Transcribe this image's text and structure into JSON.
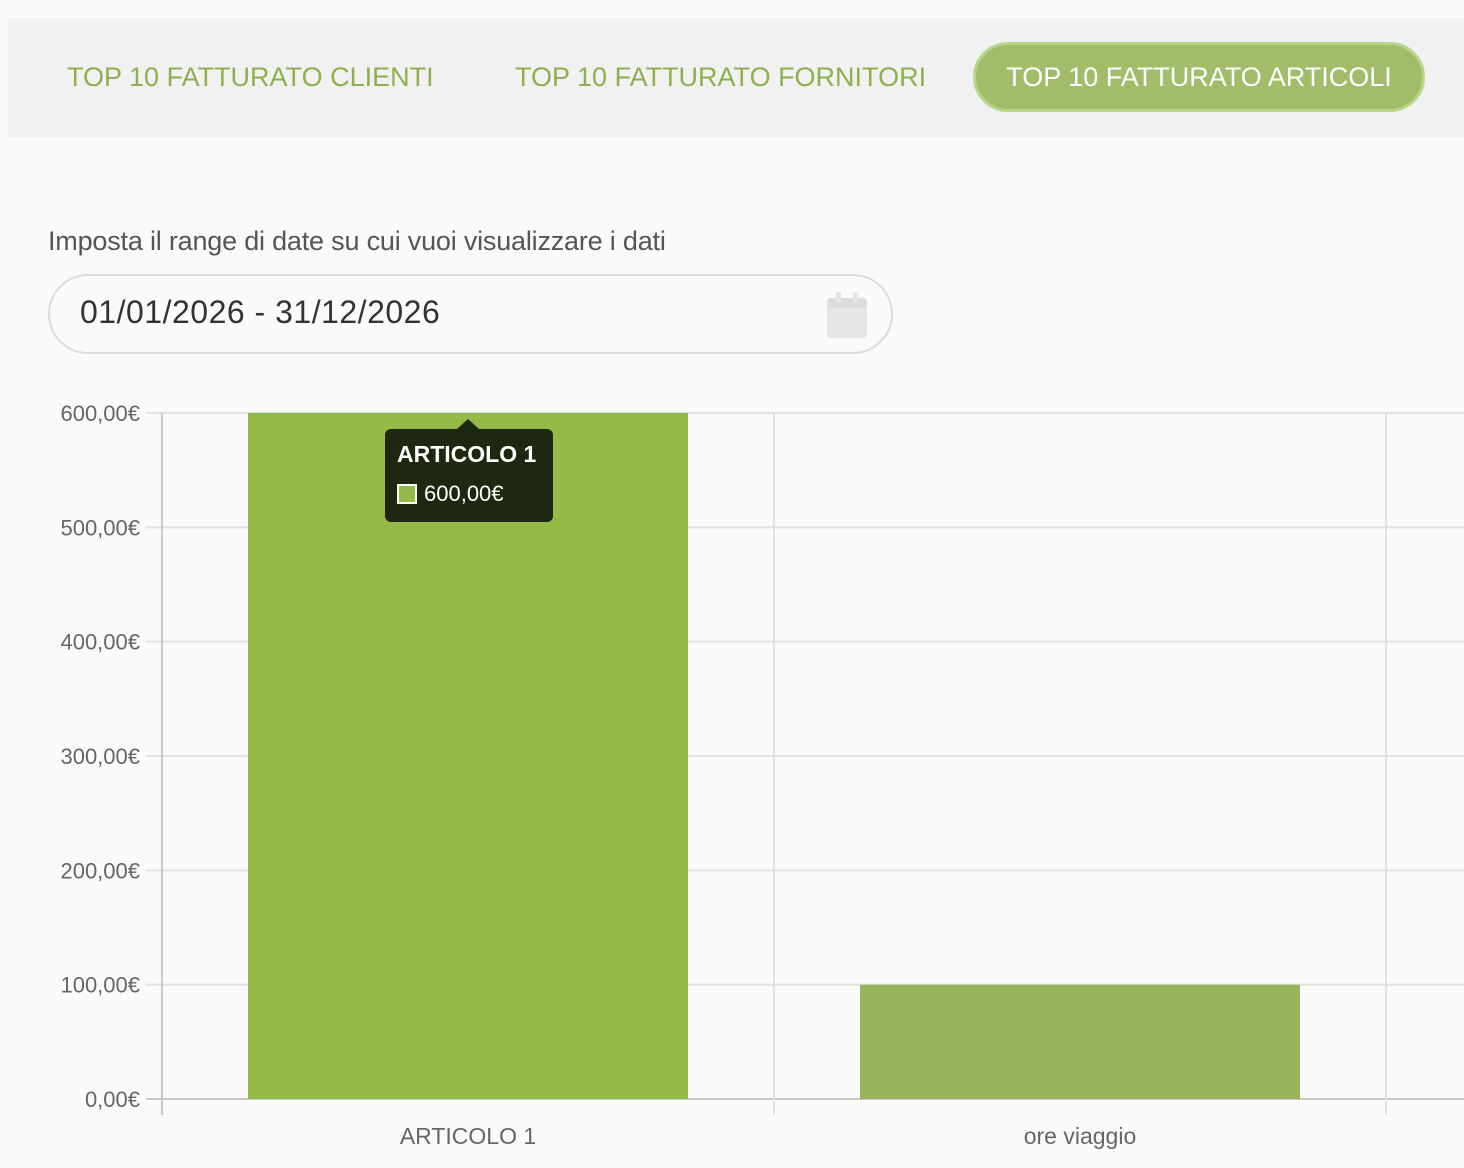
{
  "tabs": [
    {
      "label": "TOP 10 FATTURATO CLIENTI",
      "active": false
    },
    {
      "label": "TOP 10 FATTURATO FORNITORI",
      "active": false
    },
    {
      "label": "TOP 10 FATTURATO ARTICOLI",
      "active": true
    }
  ],
  "date_range": {
    "label": "Imposta il range di date su cui vuoi visualizzare i dati",
    "value": "01/01/2026 - 31/12/2026",
    "icon": "calendar-icon"
  },
  "tooltip": {
    "title": "ARTICOLO 1",
    "value": "600,00€",
    "swatch_color": "#94ba48"
  },
  "colors": {
    "accent": "#8db04e",
    "active_tab_bg": "#a1bd6a",
    "bar_primary": "#94ba48",
    "bar_secondary": "#98b45b",
    "grid": "#e2e2e2"
  },
  "chart_data": {
    "type": "bar",
    "categories": [
      "ARTICOLO 1",
      "ore viaggio"
    ],
    "values": [
      600,
      100
    ],
    "bar_colors": [
      "#94ba48",
      "#98b45b"
    ],
    "y_ticks": [
      0,
      100,
      200,
      300,
      400,
      500,
      600
    ],
    "y_tick_labels": [
      "0,00€",
      "100,00€",
      "200,00€",
      "300,00€",
      "400,00€",
      "500,00€",
      "600,00€"
    ],
    "ylim": [
      0,
      600
    ],
    "grid": true,
    "title": "",
    "xlabel": "",
    "ylabel": ""
  }
}
